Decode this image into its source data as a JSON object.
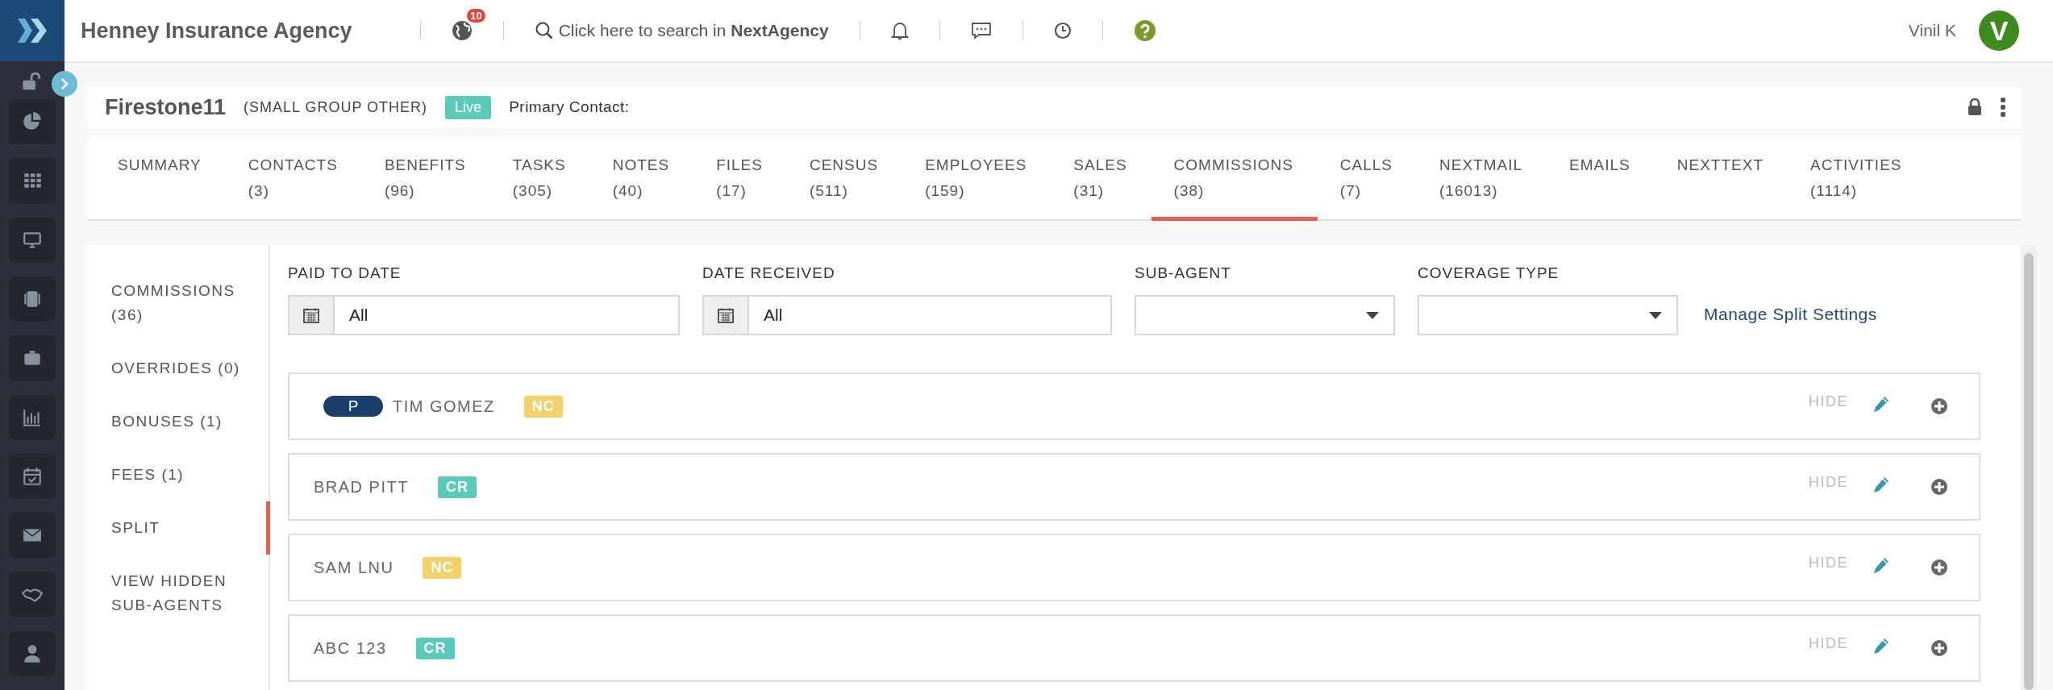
{
  "app": {
    "org_name": "Henney Insurance Agency",
    "notification_count": "10",
    "search": "Click here to search in **NextAgency**",
    "user": {
      "name": "Vinil K",
      "initial": "V"
    }
  },
  "group": {
    "name": "Firestone11",
    "type": "(SMALL GROUP OTHER)",
    "status": "Live",
    "primary_contact_label": "Primary Contact:"
  },
  "tabs": [
    {
      "label": "SUMMARY",
      "selected": false
    },
    {
      "label": "CONTACTS",
      "count": "(3)",
      "selected": false
    },
    {
      "label": "BENEFITS",
      "count": "(96)",
      "selected": false
    },
    {
      "label": "TASKS",
      "count": "(305)",
      "selected": false
    },
    {
      "label": "NOTES",
      "count": "(40)",
      "selected": false
    },
    {
      "label": "FILES",
      "count": "(17)",
      "selected": false
    },
    {
      "label": "CENSUS",
      "count": "(511)",
      "selected": false
    },
    {
      "label": "EMPLOYEES",
      "count": "(159)",
      "selected": false
    },
    {
      "label": "SALES",
      "count": "(31)",
      "selected": false
    },
    {
      "label": "COMMISSIONS",
      "count": "(38)",
      "selected": true
    },
    {
      "label": "CALLS",
      "count": "(7)",
      "selected": false
    },
    {
      "label": "NEXTMAIL",
      "count": "(16013)",
      "selected": false
    },
    {
      "label": "EMAILS",
      "selected": false
    },
    {
      "label": "NEXTTEXT",
      "selected": false
    },
    {
      "label": "ACTIVITIES",
      "count": "(1114)",
      "selected": false
    }
  ],
  "subnav": [
    {
      "label": "COMMISSIONS (36)",
      "selected": false
    },
    {
      "label": "OVERRIDES (0)",
      "selected": false
    },
    {
      "label": "BONUSES (1)",
      "selected": false
    },
    {
      "label": "FEES (1)",
      "selected": false
    },
    {
      "label": "SPLIT",
      "selected": true
    },
    {
      "label": "VIEW HIDDEN SUB-AGENTS",
      "selected": false
    }
  ],
  "filters": [
    {
      "kind": "date",
      "label": "PAID TO DATE",
      "value": "All"
    },
    {
      "kind": "date",
      "label": "DATE RECEIVED",
      "value": "All"
    },
    {
      "kind": "select",
      "label": "SUB-AGENT"
    },
    {
      "kind": "select",
      "label": "COVERAGE TYPE"
    }
  ],
  "manage_link": "Manage Split Settings",
  "agents": [
    {
      "name": "TIM GOMEZ",
      "pill": "P",
      "tag": {
        "label": "NC",
        "color": "#f2d06b"
      },
      "hide_label": "HIDE"
    },
    {
      "name": "BRAD PITT",
      "tag": {
        "label": "CR",
        "color": "#5ccabb"
      },
      "hide_label": "HIDE"
    },
    {
      "name": "SAM LNU",
      "tag": {
        "label": "NC",
        "color": "#f2d06b"
      },
      "hide_label": "HIDE"
    },
    {
      "name": "ABC 123",
      "tag": {
        "label": "CR",
        "color": "#5ccabb"
      },
      "hide_label": "HIDE"
    }
  ]
}
